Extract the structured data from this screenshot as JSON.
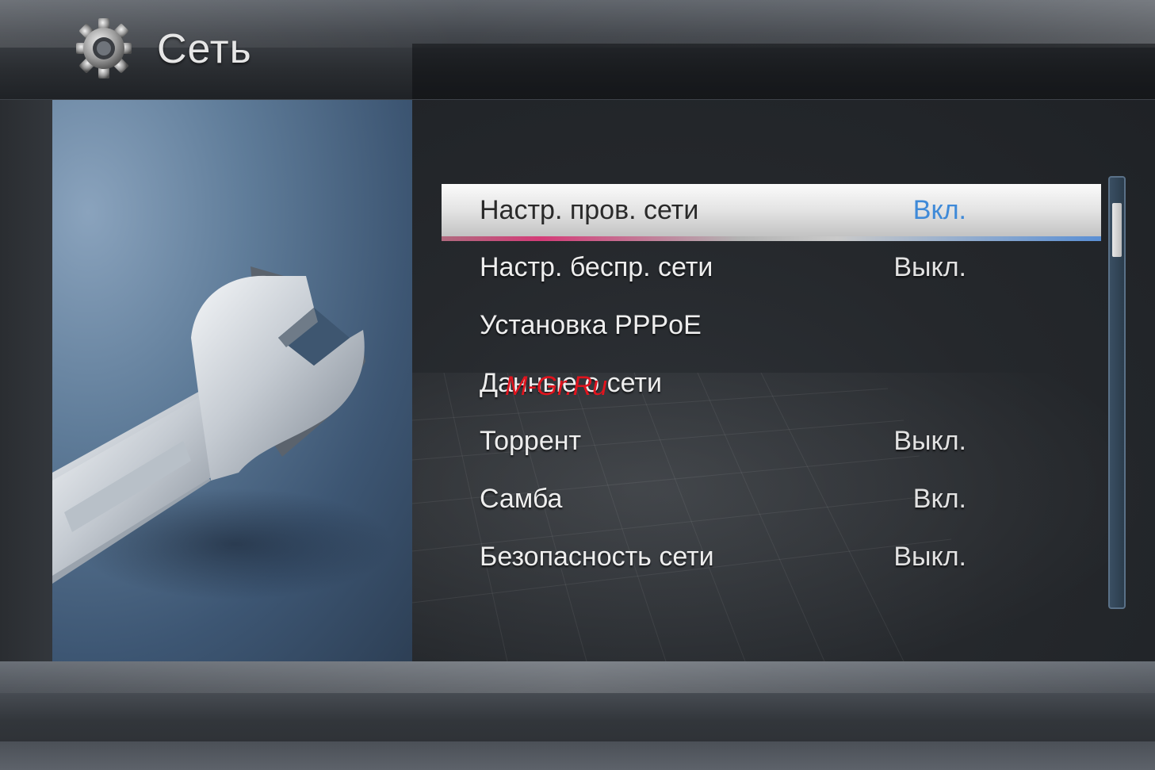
{
  "header": {
    "title": "Сеть",
    "icon": "gear-icon"
  },
  "menu": {
    "items": [
      {
        "label": "Настр. пров. сети",
        "value": "Вкл.",
        "selected": true
      },
      {
        "label": "Настр. беспр. сети",
        "value": "Выкл.",
        "selected": false
      },
      {
        "label": "Установка PPPoE",
        "value": "",
        "selected": false
      },
      {
        "label": "Данные о сети",
        "value": "",
        "selected": false
      },
      {
        "label": "Торрент",
        "value": "Выкл.",
        "selected": false
      },
      {
        "label": "Самба",
        "value": "Вкл.",
        "selected": false
      },
      {
        "label": "Безопасность сети",
        "value": "Выкл.",
        "selected": false
      }
    ]
  },
  "illustration": "wrench-icon",
  "watermark": "M-Gr.Ru",
  "colors": {
    "selected_value": "#3f8ad8",
    "watermark": "#e0141e"
  }
}
